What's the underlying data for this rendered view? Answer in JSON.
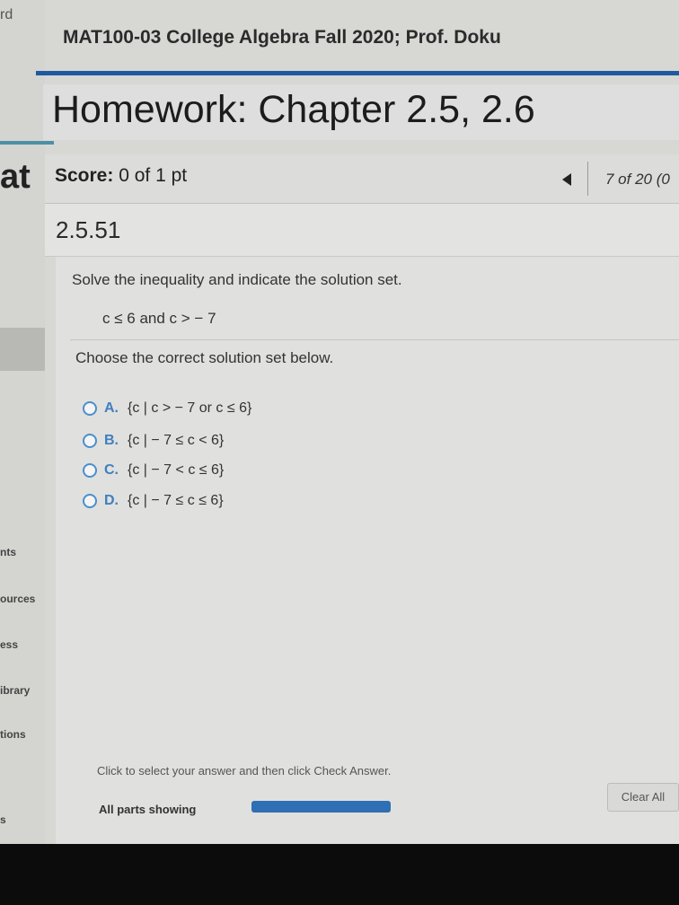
{
  "sidebar": {
    "top_fragment": "rd",
    "score_fragment": "at",
    "links": [
      "nts",
      "ources",
      "ess",
      "ibrary",
      "tions",
      "s"
    ]
  },
  "header": {
    "course_title": "MAT100-03 College Algebra Fall 2020; Prof. Doku",
    "homework_title": "Homework: Chapter 2.5, 2.6"
  },
  "score": {
    "label": "Score:",
    "value": "0 of 1 pt"
  },
  "navigation": {
    "prev_icon": "triangle-left-icon",
    "count": "7 of 20 (0"
  },
  "question": {
    "number": "2.5.51",
    "prompt": "Solve the inequality and indicate the solution set.",
    "inequality": "c ≤ 6 and c > − 7",
    "instruction": "Choose the correct solution set below.",
    "options": [
      {
        "letter": "A.",
        "text": "{c | c > − 7 or c ≤ 6}"
      },
      {
        "letter": "B.",
        "text": "{c | − 7 ≤ c < 6}"
      },
      {
        "letter": "C.",
        "text": "{c | − 7 < c ≤ 6}"
      },
      {
        "letter": "D.",
        "text": "{c | − 7 ≤ c ≤ 6}"
      }
    ]
  },
  "footer": {
    "instruction": "Click to select your answer and then click Check Answer.",
    "parts_label": "All parts showing",
    "progress": 1.0,
    "clear_all_label": "Clear All"
  },
  "colors": {
    "accent_rule": "#1f5aa0",
    "radio_border": "#4a8fcc",
    "progress_fill": "#2f6fb3"
  }
}
